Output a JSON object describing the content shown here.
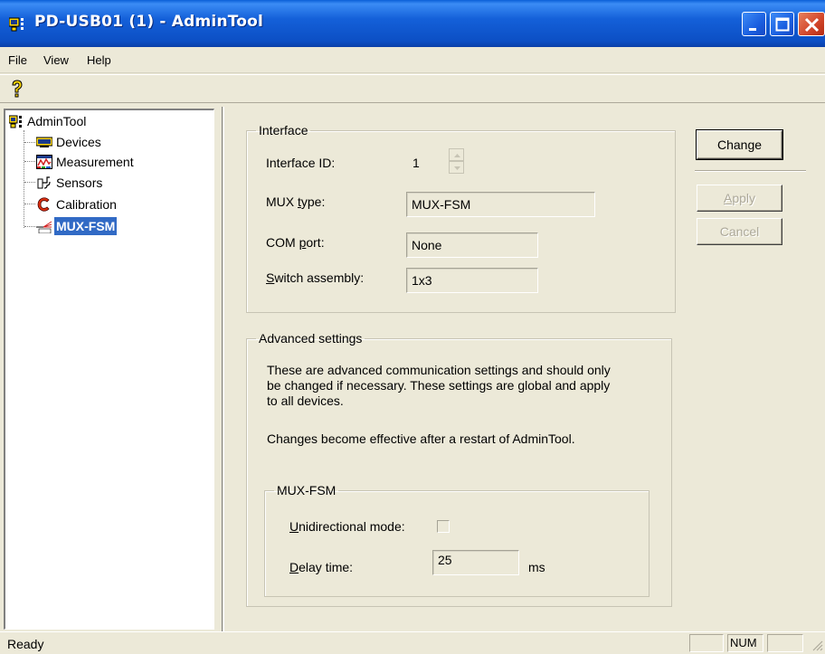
{
  "window": {
    "title": "PD-USB01 (1) - AdminTool",
    "controls": [
      "minimize",
      "maximize",
      "close"
    ]
  },
  "menu": {
    "items": [
      "File",
      "View",
      "Help"
    ]
  },
  "toolbar": {
    "icons": [
      "help-icon"
    ]
  },
  "tree": {
    "root": "AdminTool",
    "items": [
      {
        "label": "Devices",
        "icon": "devices-icon"
      },
      {
        "label": "Measurement",
        "icon": "measurement-icon"
      },
      {
        "label": "Sensors",
        "icon": "sensors-icon"
      },
      {
        "label": "Calibration",
        "icon": "calibration-icon"
      },
      {
        "label": "MUX-FSM",
        "icon": "mux-fsm-icon",
        "selected": true
      }
    ],
    "selection_color": "#316ac5"
  },
  "interface": {
    "legend": "Interface",
    "interface_id_label": "Interface ID:",
    "interface_id_value": "1",
    "mux_type_label_pre": "MUX ",
    "mux_type_label_u": "t",
    "mux_type_label_post": "ype:",
    "mux_type_value": "MUX-FSM",
    "com_port_label_pre": "COM ",
    "com_port_label_u": "p",
    "com_port_label_post": "ort:",
    "com_port_value": "None",
    "switch_label_u": "S",
    "switch_label_post": "witch assembly:",
    "switch_value": "1x3"
  },
  "advanced": {
    "legend": "Advanced settings",
    "description": "These are advanced communication settings and should only\nbe changed if necessary. These settings are global and apply\nto all devices.",
    "note": "Changes become effective after a restart of AdminTool.",
    "mux": {
      "legend": "MUX-FSM",
      "unidirectional_label_u": "U",
      "unidirectional_label_post": "nidirectional mode:",
      "unidirectional_checked": false,
      "delay_label_u": "D",
      "delay_label_post": "elay time:",
      "delay_value": "25",
      "delay_unit": "ms"
    }
  },
  "buttons": {
    "change": "Change",
    "apply_u": "A",
    "apply_post": "pply",
    "cancel": "Cancel"
  },
  "statusbar": {
    "text": "Ready",
    "num": "NUM"
  }
}
